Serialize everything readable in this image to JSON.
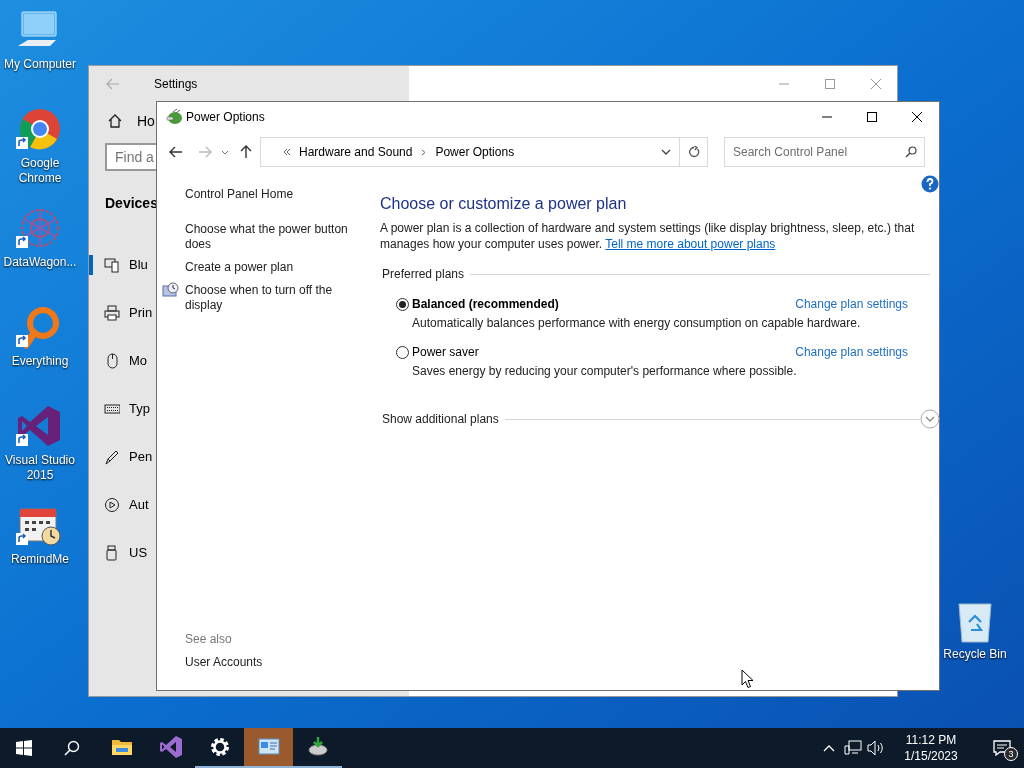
{
  "desktop_icons": [
    {
      "label": "My Computer",
      "kind": "computer",
      "shortcut": false
    },
    {
      "label": "Google Chrome",
      "kind": "chrome",
      "shortcut": true
    },
    {
      "label": "DataWagon...",
      "kind": "datawagon",
      "shortcut": true
    },
    {
      "label": "Everything",
      "kind": "everything",
      "shortcut": true
    },
    {
      "label": "Visual Studio 2015",
      "kind": "vs",
      "shortcut": true
    },
    {
      "label": "RemindMe",
      "kind": "calendar",
      "shortcut": true
    }
  ],
  "recycle_bin": {
    "label": "Recycle Bin"
  },
  "settings_window": {
    "title": "Settings",
    "home": "Ho",
    "search_placeholder": "Find a",
    "section": "Devices",
    "items": [
      {
        "label": "Blu",
        "kind": "bluetooth",
        "selected": true
      },
      {
        "label": "Prin",
        "kind": "printer",
        "selected": false
      },
      {
        "label": "Mo",
        "kind": "mouse",
        "selected": false
      },
      {
        "label": "Typ",
        "kind": "keyboard",
        "selected": false
      },
      {
        "label": "Pen",
        "kind": "pen",
        "selected": false
      },
      {
        "label": "Aut",
        "kind": "autoplay",
        "selected": false
      },
      {
        "label": "US",
        "kind": "usb",
        "selected": false
      }
    ]
  },
  "power_window": {
    "title": "Power Options",
    "breadcrumb": [
      "Hardware and Sound",
      "Power Options"
    ],
    "search_placeholder": "Search Control Panel",
    "home_link": "Control Panel Home",
    "tasks": [
      {
        "label": "Choose what the power button does",
        "kind": "plain"
      },
      {
        "label": "Create a power plan",
        "kind": "plain"
      },
      {
        "label": "Choose when to turn off the display",
        "kind": "clock"
      }
    ],
    "see_also": {
      "heading": "See also",
      "links": [
        "User Accounts"
      ]
    },
    "heading": "Choose or customize a power plan",
    "intro": "A power plan is a collection of hardware and system settings (like display brightness, sleep, etc.) that manages how your computer uses power.",
    "intro_link": "Tell me more about power plans",
    "plans_heading": "Preferred plans",
    "plans": [
      {
        "name": "Balanced (recommended)",
        "selected": true,
        "link": "Change plan settings",
        "description": "Automatically balances performance with energy consumption on capable hardware."
      },
      {
        "name": "Power saver",
        "selected": false,
        "link": "Change plan settings",
        "description": "Saves energy by reducing your computer's performance where possible."
      }
    ],
    "additional": "Show additional plans"
  },
  "taskbar": {
    "apps": [
      {
        "kind": "explorer",
        "running": false,
        "active": false
      },
      {
        "kind": "vs",
        "running": false,
        "active": false
      },
      {
        "kind": "settings",
        "running": true,
        "active": false
      },
      {
        "kind": "controlpanel",
        "running": true,
        "active": true
      },
      {
        "kind": "power",
        "running": true,
        "active": false
      }
    ],
    "time": "11:12 PM",
    "date": "1/15/2023",
    "notifications": "3"
  }
}
